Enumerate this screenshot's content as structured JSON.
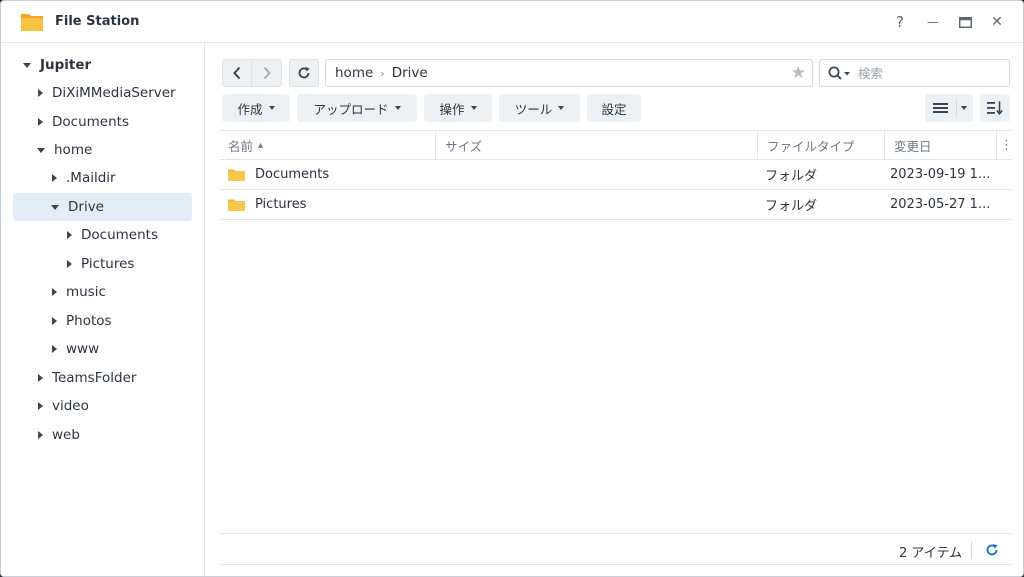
{
  "window": {
    "title": "File Station",
    "help_label": "?",
    "minimize_label": "—",
    "close_label": "✕"
  },
  "sidebar": {
    "items": [
      {
        "label": "Jupiter"
      },
      {
        "label": "DiXiMMediaServer"
      },
      {
        "label": "Documents"
      },
      {
        "label": "home"
      },
      {
        "label": ".Maildir"
      },
      {
        "label": "Drive"
      },
      {
        "label": "Documents"
      },
      {
        "label": "Pictures"
      },
      {
        "label": "music"
      },
      {
        "label": "Photos"
      },
      {
        "label": "www"
      },
      {
        "label": "TeamsFolder"
      },
      {
        "label": "video"
      },
      {
        "label": "web"
      }
    ]
  },
  "path": {
    "segments": [
      "home",
      "Drive"
    ],
    "separator": "›"
  },
  "search": {
    "placeholder": "検索"
  },
  "toolbar": {
    "create_label": "作成",
    "upload_label": "アップロード",
    "action_label": "操作",
    "tools_label": "ツール",
    "settings_label": "設定"
  },
  "table": {
    "columns": [
      "名前",
      "サイズ",
      "ファイルタイプ",
      "変更日"
    ],
    "sort_indicator": "▴",
    "rows": [
      {
        "name": "Documents",
        "size": "",
        "type": "フォルダ",
        "modified": "2023-09-19 1..."
      },
      {
        "name": "Pictures",
        "size": "",
        "type": "フォルダ",
        "modified": "2023-05-27 1..."
      }
    ]
  },
  "footer": {
    "count_text": "2 アイテム"
  },
  "colors": {
    "accent": "#1a73c9",
    "folder": "#f7c242",
    "selected_bg": "#e3edf8"
  }
}
